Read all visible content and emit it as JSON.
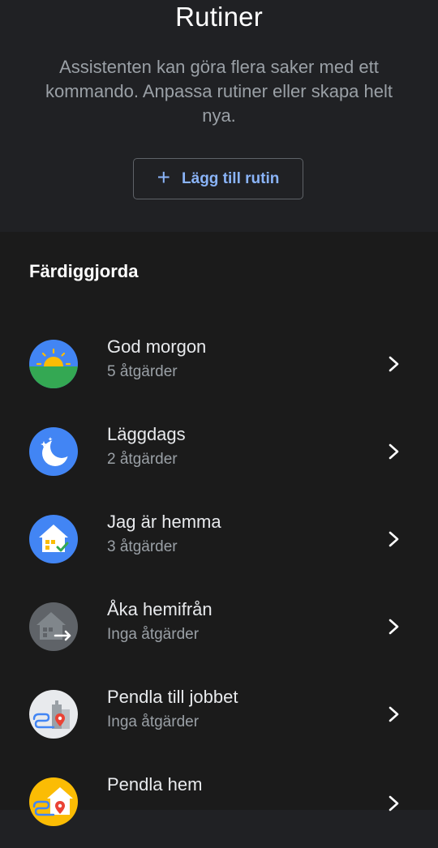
{
  "header": {
    "title": "Rutiner",
    "description": "Assistenten kan göra flera saker med ett kommando. Anpassa rutiner eller skapa helt nya.",
    "add_button_label": "Lägg till rutin"
  },
  "section": {
    "title": "Färdiggjorda"
  },
  "routines": [
    {
      "name": "God morgon",
      "actions": "5 åtgärder",
      "icon": "sunrise-icon"
    },
    {
      "name": "Läggdags",
      "actions": "2 åtgärder",
      "icon": "moon-icon"
    },
    {
      "name": "Jag är hemma",
      "actions": "3 åtgärder",
      "icon": "home-check-icon"
    },
    {
      "name": "Åka hemifrån",
      "actions": "Inga åtgärder",
      "icon": "home-leave-icon"
    },
    {
      "name": "Pendla till jobbet",
      "actions": "Inga åtgärder",
      "icon": "commute-work-icon"
    },
    {
      "name": "Pendla hem",
      "actions": "",
      "icon": "commute-home-icon"
    }
  ],
  "colors": {
    "background_top": "#202124",
    "background_list": "#1b1b1b",
    "accent": "#8ab4f8",
    "text_primary": "#e8eaed",
    "text_secondary": "#9aa0a6"
  }
}
